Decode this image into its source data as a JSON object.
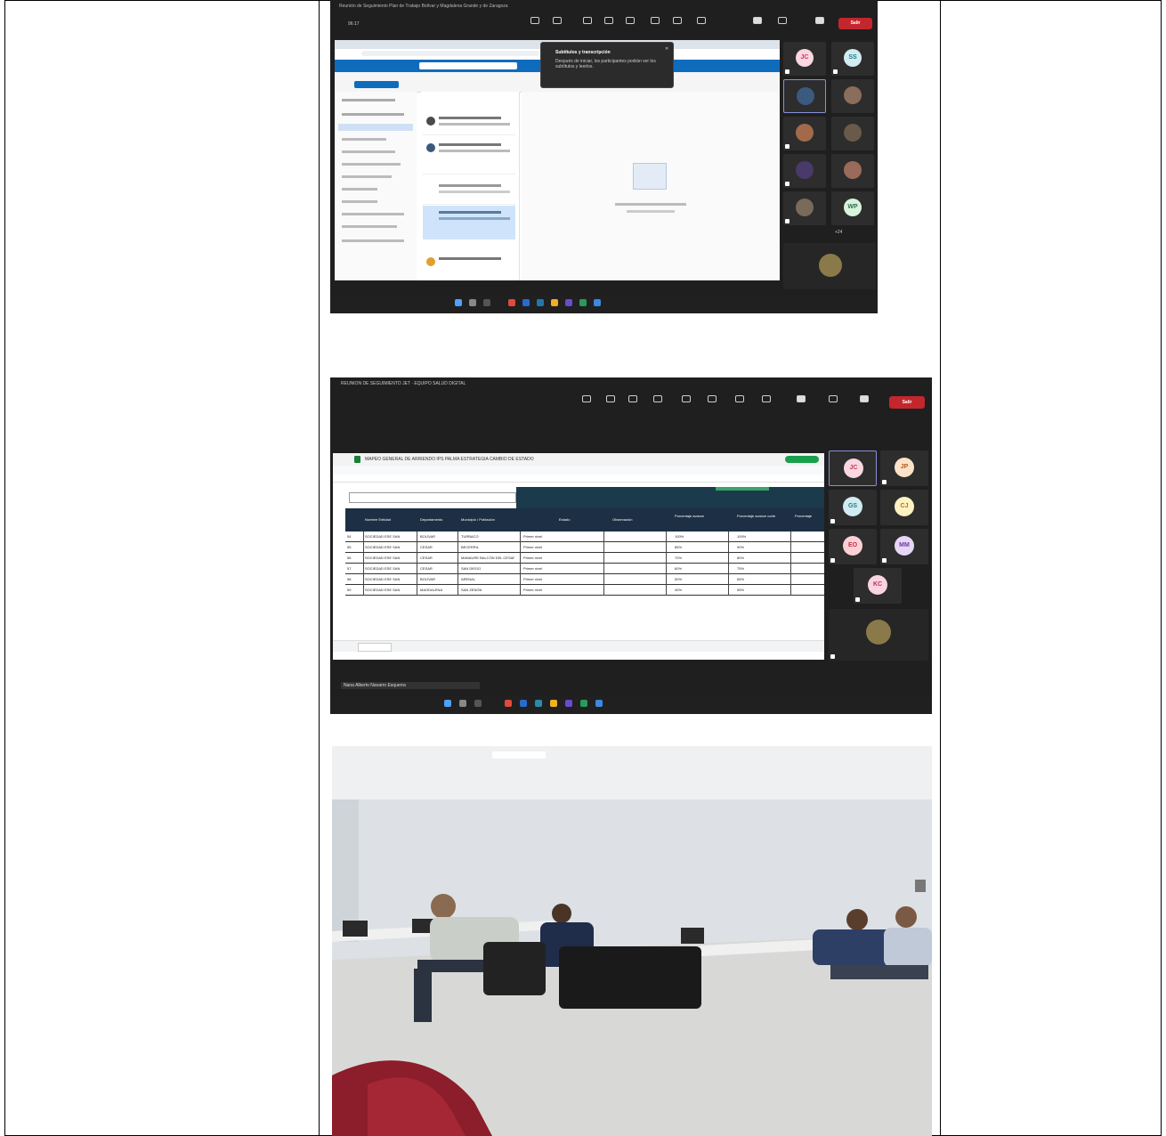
{
  "screenshot1": {
    "window_title": "Reunión de Seguimiento Plan de Trabajo Bolívar y Magdalena Grande y de Zaragoza",
    "meeting_timer": "96:17",
    "toolbar": [
      "Chat",
      "Personas",
      "Reaccionar",
      "Ver",
      "Notas",
      "Más"
    ],
    "leave_label": "Salir",
    "notification_title": "Subtítulos y transcripción",
    "notification_body": "Después de iniciar, los participantes podrán ver los subtítulos y leerlos.",
    "search_placeholder": "Buscar",
    "participants": [
      {
        "initials": "JC",
        "bg": "#f8d7e0",
        "fg": "#c43a5b"
      },
      {
        "initials": "SS",
        "bg": "#d1ecf1",
        "fg": "#1f7b8c"
      },
      {
        "initials": "",
        "bg": "#3b5a80",
        "fg": "#ffffff"
      },
      {
        "initials": "",
        "bg": "#8a6d5a",
        "fg": "#ffffff"
      },
      {
        "initials": "",
        "bg": "#a26a4a",
        "fg": "#ffffff"
      },
      {
        "initials": "",
        "bg": "#6a5a4a",
        "fg": "#ffffff"
      },
      {
        "initials": "",
        "bg": "#4a3a6a",
        "fg": "#ffffff"
      },
      {
        "initials": "",
        "bg": "#9a6a5a",
        "fg": "#ffffff"
      },
      {
        "initials": "",
        "bg": "#7a6a5a",
        "fg": "#ffffff"
      },
      {
        "initials": "WP",
        "bg": "#d8f3dc",
        "fg": "#2d6a4f"
      }
    ],
    "more_count": "+24"
  },
  "screenshot2": {
    "window_title": "REUNIÓN DE SEGUIMIENTO JET · EQUIPO SALUD DIGITAL",
    "leave_label": "Salir",
    "toolbar": [
      "Chat",
      "Personas",
      "Reaccionar",
      "Ver",
      "Notas",
      "Más"
    ],
    "sheet_title": "MAPEO GENERAL DE ARRIENDO IPS PALMA ESTRATEGIA CAMBIO DE ESTADO",
    "columns": [
      "Ítem",
      "Nombre Entidad",
      "Departamento",
      "Municipio / Población",
      "",
      "Estado",
      "Observación",
      "Porcentaje avance",
      "Porcentaje avance corte",
      "Porcentaje"
    ],
    "rows": [
      {
        "n": "54",
        "ent": "SOCIEDAD ESE SAN",
        "dep": "BOLÍVAR",
        "mun": "TURBACO",
        "est": "Primer nivel",
        "p1": "100%",
        "p2": "100%"
      },
      {
        "n": "55",
        "ent": "SOCIEDAD ESE SAN",
        "dep": "CESAR",
        "mun": "BECERRIL",
        "est": "Primer nivel",
        "p1": "85%",
        "p2": "90%"
      },
      {
        "n": "56",
        "ent": "SOCIEDAD ESE SAN",
        "dep": "CESAR",
        "mun": "MANAURE BALCÓN DEL CESAR",
        "est": "Primer nivel",
        "p1": "70%",
        "p2": "80%"
      },
      {
        "n": "57",
        "ent": "SOCIEDAD ESE SAN",
        "dep": "CESAR",
        "mun": "SAN DIEGO",
        "est": "Primer nivel",
        "p1": "60%",
        "p2": "75%"
      },
      {
        "n": "58",
        "ent": "SOCIEDAD ESE SAN",
        "dep": "BOLÍVAR",
        "mun": "ARENAL",
        "est": "Primer nivel",
        "p1": "50%",
        "p2": "65%"
      },
      {
        "n": "59",
        "ent": "SOCIEDAD ESE SAN",
        "dep": "MAGDALENA",
        "mun": "SAN ZENÓN",
        "est": "Primer nivel",
        "p1": "40%",
        "p2": "55%"
      }
    ],
    "participants": [
      {
        "initials": "JC",
        "bg": "#f8d7e0",
        "fg": "#c43a5b"
      },
      {
        "initials": "JP",
        "bg": "#fde2c8",
        "fg": "#b35c1e"
      },
      {
        "initials": "GS",
        "bg": "#d1ecf1",
        "fg": "#1f7b8c"
      },
      {
        "initials": "CJ",
        "bg": "#fff1c1",
        "fg": "#a07a10"
      },
      {
        "initials": "EO",
        "bg": "#fbd0d5",
        "fg": "#c2304a"
      },
      {
        "initials": "MM",
        "bg": "#e6d7f5",
        "fg": "#6b3fa0"
      },
      {
        "initials": "KC",
        "bg": "#f9d3e0",
        "fg": "#b8306b"
      }
    ],
    "status_text": "Nana Alberto Navarro Esquerra"
  }
}
